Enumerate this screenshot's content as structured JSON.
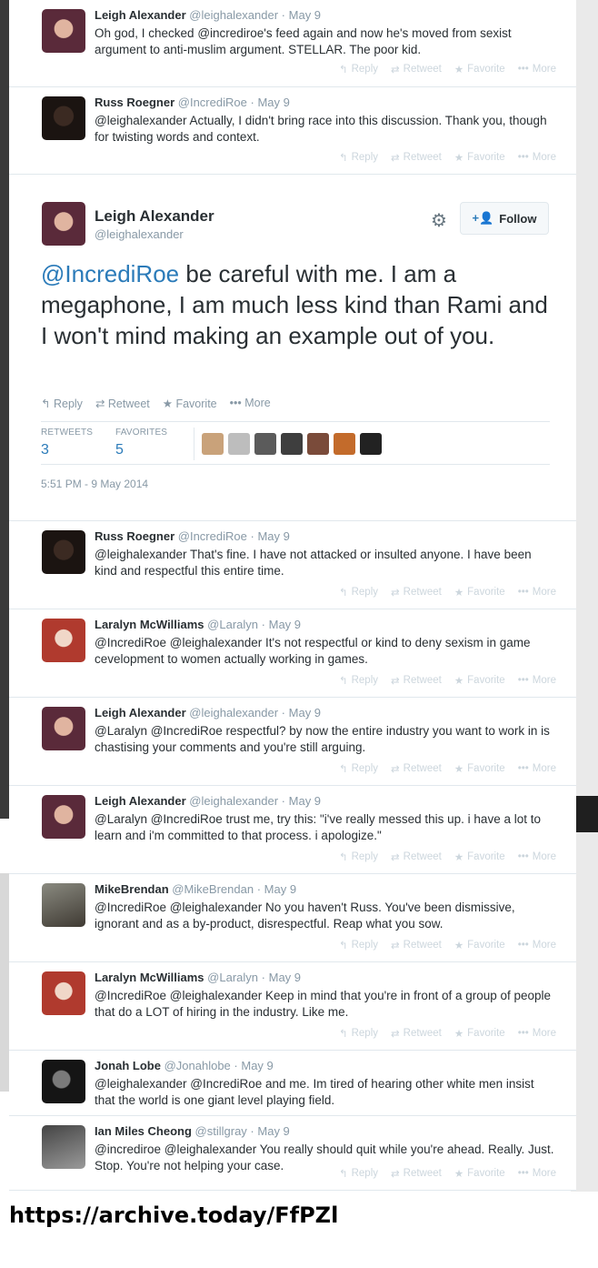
{
  "actions": {
    "reply": "Reply",
    "retweet": "Retweet",
    "favorite": "Favorite",
    "more": "More"
  },
  "top_tweets": [
    {
      "name": "Leigh Alexander",
      "handle": "@leighalexander",
      "date": "May 9",
      "text": "Oh god, I checked @incrediroe's feed again and now he's moved from sexist argument to anti-muslim argument. STELLAR. The poor kid."
    },
    {
      "name": "Russ Roegner",
      "handle": "@IncrediRoe",
      "date": "May 9",
      "text": "@leighalexander Actually, I didn't bring race into this discussion. Thank you, though for twisting words and context."
    }
  ],
  "main_tweet": {
    "name": "Leigh Alexander",
    "handle": "@leighalexander",
    "follow_label": "Follow",
    "mention": "@IncrediRoe",
    "text": " be careful with me. I am a megaphone, I am much less kind than Rami and I won't mind making an example out of you.",
    "retweets_label": "RETWEETS",
    "retweets": "3",
    "favorites_label": "FAVORITES",
    "favorites": "5",
    "timestamp": "5:51 PM - 9 May 2014",
    "favoriter_colors": [
      "#c9a27a",
      "#bdbdbd",
      "#5b5b5b",
      "#3e3e3e",
      "#7a4b3a",
      "#c36b2b",
      "#222222"
    ]
  },
  "replies": [
    {
      "name": "Russ Roegner",
      "handle": "@IncrediRoe",
      "date": "May 9",
      "text": "@leighalexander That's fine. I have not attacked or insulted anyone. I have been kind and respectful this entire time."
    },
    {
      "name": "Laralyn McWilliams",
      "handle": "@Laralyn",
      "date": "May 9",
      "text": "@IncrediRoe @leighalexander It's not respectful or kind to deny sexism in game cevelopment to women actually working in games."
    },
    {
      "name": "Leigh Alexander",
      "handle": "@leighalexander",
      "date": "May 9",
      "text": "@Laralyn @IncrediRoe respectful? by now the entire industry you want to work in is chastising your comments and you're still arguing."
    },
    {
      "name": "Leigh Alexander",
      "handle": "@leighalexander",
      "date": "May 9",
      "text": "@Laralyn @IncrediRoe trust me, try this: \"i've really messed this up. i have a lot to learn and i'm committed to that process. i apologize.\""
    },
    {
      "name": "MikeBrendan",
      "handle": "@MikeBrendan",
      "date": "May 9",
      "text": "@IncrediRoe @leighalexander No you haven't Russ. You've been dismissive, ignorant and as a by-product, disrespectful. Reap what you sow."
    },
    {
      "name": "Laralyn McWilliams",
      "handle": "@Laralyn",
      "date": "May 9",
      "text": "@IncrediRoe @leighalexander Keep in mind that you're in front of a group of people that do a LOT of hiring in the industry. Like me."
    },
    {
      "name": "Jonah Lobe",
      "handle": "@Jonahlobe",
      "date": "May 9",
      "text": "@leighalexander @IncrediRoe and me.  Im tired of hearing other white men insist that the world is one giant level playing field."
    },
    {
      "name": "Ian Miles Cheong",
      "handle": "@stillgray",
      "date": "May 9",
      "text": "@incrediroe @leighalexander You really should quit while you're ahead. Really. Just. Stop. You're not helping your case."
    }
  ],
  "footer_url": "https://archive.today/FfPZl"
}
